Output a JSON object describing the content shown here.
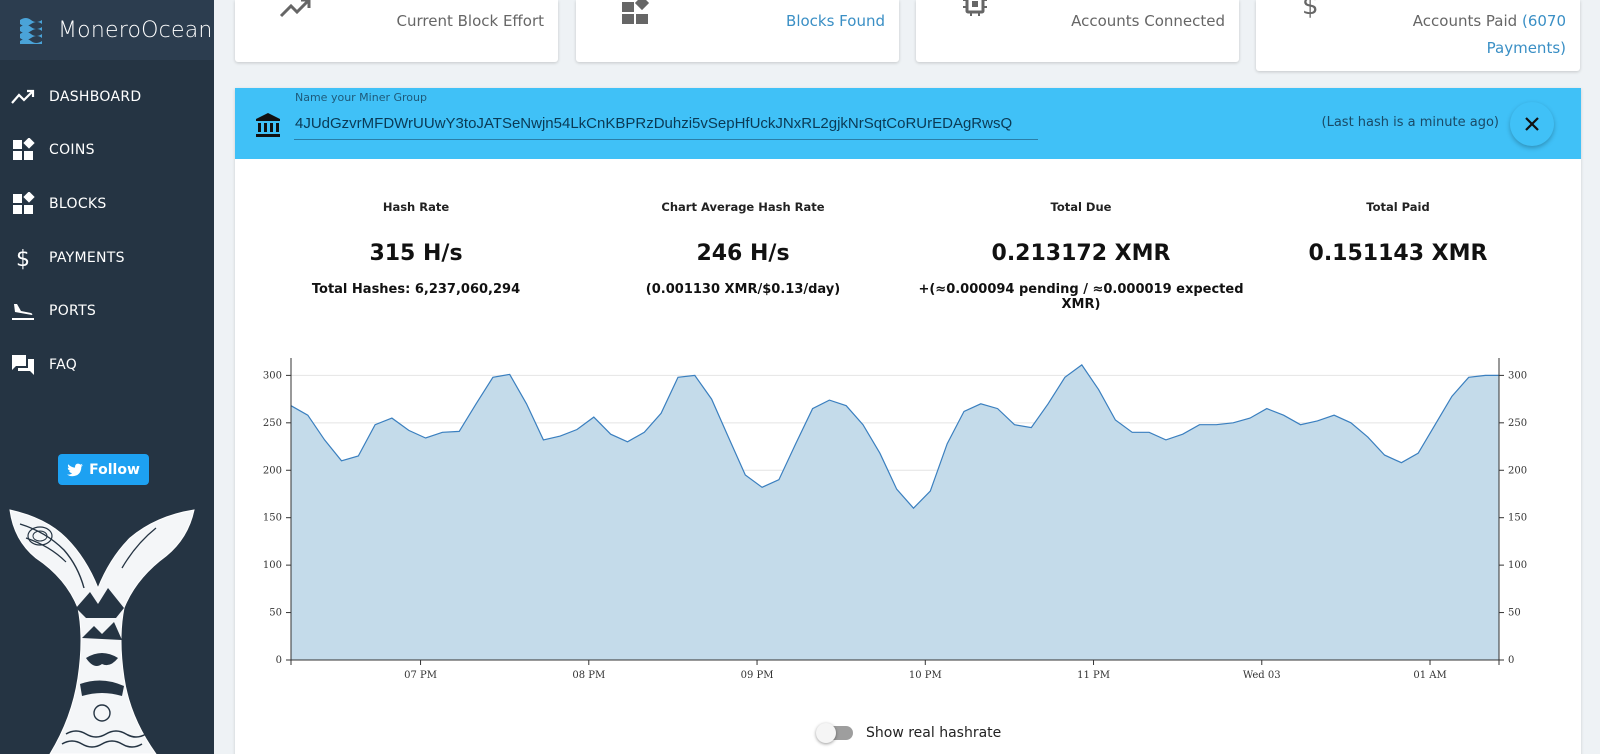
{
  "app": {
    "name": "MoneroOcean"
  },
  "sidebar": {
    "items": [
      {
        "label": "DASHBOARD",
        "icon": "trending-icon"
      },
      {
        "label": "COINS",
        "icon": "widgets-icon"
      },
      {
        "label": "BLOCKS",
        "icon": "widgets-icon"
      },
      {
        "label": "PAYMENTS",
        "icon": "dollar-icon"
      },
      {
        "label": "PORTS",
        "icon": "flight-land-icon"
      },
      {
        "label": "FAQ",
        "icon": "forum-icon"
      }
    ],
    "follow_label": "Follow"
  },
  "cards": [
    {
      "label": "Current Block Effort",
      "icon": "trending-icon"
    },
    {
      "label": "Blocks Found",
      "icon": "widgets-icon"
    },
    {
      "label": "Accounts Connected",
      "icon": "chip-icon"
    },
    {
      "label_prefix": "Accounts Paid",
      "label_link": "(6070",
      "label_link2": "Payments)",
      "icon": "dollar-icon"
    }
  ],
  "miner_group": {
    "label": "Name your Miner Group",
    "value": "4JUdGzvrMFDWrUUwY3toJATSeNwjn54LkCnKBPRzDuhzi5vSepHfUckJNxRL2gjkNrSqtCoRUrEDAgRwsQ",
    "last_hash": "(Last hash is a minute ago)"
  },
  "stats": [
    {
      "title": "Hash Rate",
      "value": "315 H/s",
      "sub": "Total Hashes: 6,237,060,294"
    },
    {
      "title": "Chart Average Hash Rate",
      "value": "246 H/s",
      "sub": "(0.001130 XMR/$0.13/day)"
    },
    {
      "title": "Total Due",
      "value": "0.213172 XMR",
      "sub": "+(≈0.000094 pending / ≈0.000019 expected XMR)"
    },
    {
      "title": "Total Paid",
      "value": "0.151143 XMR",
      "sub": ""
    }
  ],
  "toggle": {
    "label": "Show real hashrate",
    "on": false
  },
  "colors": {
    "sidebar": "#253443",
    "accent": "#40c1f7",
    "twitter": "#1da1f2",
    "area_fill": "#c4dbea",
    "line": "#3a7fbf"
  },
  "chart_data": {
    "type": "area",
    "xlabel": "",
    "ylabel": "",
    "ylim": [
      0,
      300
    ],
    "yticks": [
      "0",
      "50",
      "100",
      "150",
      "200",
      "250",
      "300"
    ],
    "xticks": [
      "07 PM",
      "08 PM",
      "09 PM",
      "10 PM",
      "11 PM",
      "Wed 03",
      "01 AM"
    ],
    "xtick_hours": [
      1,
      2,
      3,
      4,
      5,
      6,
      7
    ],
    "x_range_hours": [
      0.23,
      7.41
    ],
    "series": [
      {
        "x": [
          0.23,
          0.33,
          0.43,
          0.53,
          0.63,
          0.73,
          0.83,
          0.93,
          1.03,
          1.13,
          1.23,
          1.33,
          1.43,
          1.53,
          1.63,
          1.73,
          1.83,
          1.93,
          2.03,
          2.13,
          2.23,
          2.33,
          2.43,
          2.53,
          2.63,
          2.73,
          2.83,
          2.93,
          3.03,
          3.13,
          3.23,
          3.33,
          3.43,
          3.53,
          3.63,
          3.73,
          3.83,
          3.93,
          4.03,
          4.13,
          4.23,
          4.33,
          4.43,
          4.53,
          4.63,
          4.73,
          4.83,
          4.93,
          5.03,
          5.13,
          5.23,
          5.33,
          5.43,
          5.53,
          5.63,
          5.73,
          5.83,
          5.93,
          6.03,
          6.13,
          6.23,
          6.33,
          6.43,
          6.53,
          6.63,
          6.73,
          6.83,
          6.93,
          7.03,
          7.13,
          7.23,
          7.33,
          7.41
        ],
        "values": [
          268,
          258,
          232,
          210,
          215,
          248,
          255,
          242,
          234,
          240,
          241,
          270,
          298,
          301,
          270,
          232,
          236,
          243,
          256,
          238,
          230,
          240,
          260,
          298,
          300,
          275,
          235,
          195,
          182,
          190,
          228,
          265,
          274,
          268,
          248,
          218,
          180,
          160,
          178,
          228,
          262,
          270,
          265,
          248,
          245,
          270,
          298,
          311,
          285,
          253,
          240,
          240,
          232,
          238,
          248,
          248,
          250,
          255,
          265,
          258,
          248,
          252,
          258,
          250,
          235,
          216,
          208,
          218,
          248,
          278,
          298,
          300,
          300
        ]
      }
    ]
  }
}
